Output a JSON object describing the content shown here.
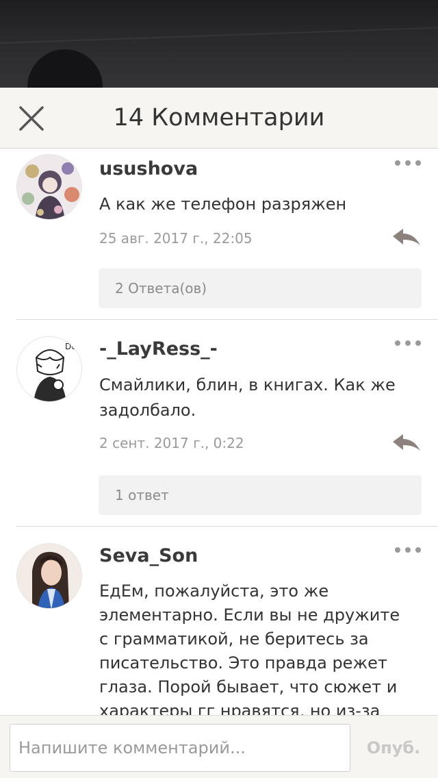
{
  "header": {
    "title": "14 Комментарии",
    "close_icon": "close-icon"
  },
  "comments": [
    {
      "username": "usushova",
      "text": "А как же телефон разряжен",
      "timestamp": "25 авг. 2017 г., 22:05",
      "replies_label": "2 Ответа(ов)"
    },
    {
      "username": "-_LayRess_-",
      "text": "Смайлики, блин, в книгах. Как же задолбало.",
      "timestamp": "2 сент. 2017 г., 0:22",
      "replies_label": "1 ответ"
    },
    {
      "username": "Seva_Son",
      "text": "ЕдЕм, пожалуйста, это же элементарно. Если вы не дружите с грамматикой, не беритесь за писательство. Это правда режет глаза. Порой бывает, что сюжет и характеры гг нравятся, но из-за"
    }
  ],
  "footer": {
    "input_placeholder": "Напишите комментарий...",
    "publish_label": "Опуб."
  },
  "colors": {
    "header_bg": "#f7f5f1",
    "text_primary": "#333333",
    "text_muted": "#9a9a9a",
    "reply_icon": "#8c817c",
    "replies_button_bg": "#f2f2f2"
  },
  "icons": [
    "close-icon",
    "more-dots-icon",
    "reply-arrow-icon"
  ]
}
